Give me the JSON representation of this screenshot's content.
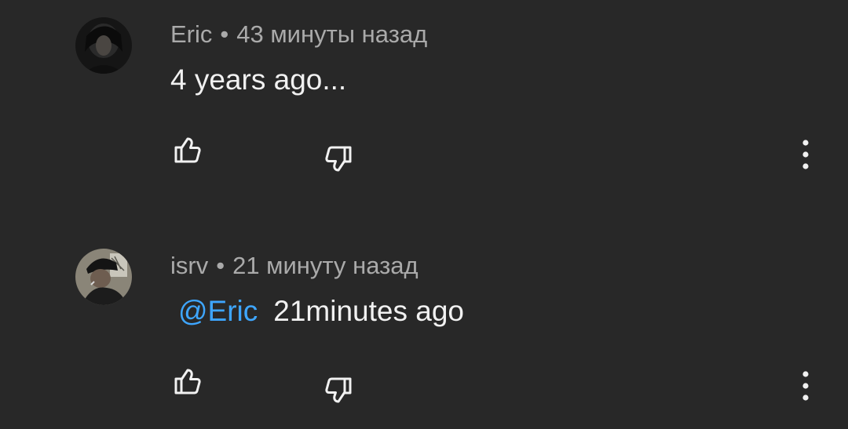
{
  "comments": [
    {
      "author": "Eric",
      "separator": "•",
      "time": "43 минуты назад",
      "text": "4 years ago...",
      "mention": "",
      "avatar_icon": "user-avatar-dark-portrait"
    },
    {
      "author": "isrv",
      "separator": "•",
      "time": "21 минуту назад",
      "mention": "@Eric",
      "text": "21minutes ago",
      "avatar_icon": "user-avatar-cap-portrait"
    }
  ],
  "icons": {
    "like": "thumb-up-outline-icon",
    "dislike": "thumb-down-outline-icon",
    "more": "vertical-dots-icon"
  },
  "colors": {
    "background": "#282828",
    "text_primary": "#f1f1f1",
    "text_secondary": "#aaaaaa",
    "mention": "#3ea6ff"
  }
}
